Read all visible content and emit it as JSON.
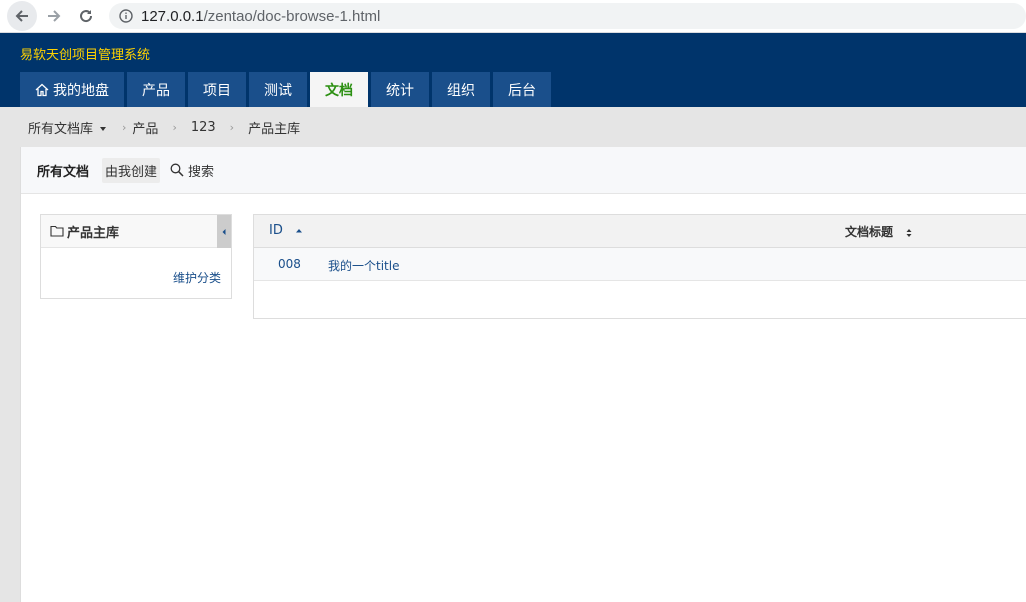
{
  "browser": {
    "url_host": "127.0.0.1",
    "url_path": "/zentao/doc-browse-1.html"
  },
  "app": {
    "title": "易软天创项目管理系统"
  },
  "main_nav": {
    "tabs": [
      {
        "label": "我的地盘",
        "icon": "home-icon"
      },
      {
        "label": "产品"
      },
      {
        "label": "项目"
      },
      {
        "label": "测试"
      },
      {
        "label": "文档",
        "active": true
      },
      {
        "label": "统计"
      },
      {
        "label": "组织"
      },
      {
        "label": "后台"
      }
    ]
  },
  "breadcrumb": {
    "items": [
      "所有文档库",
      "产品",
      "123",
      "产品主库"
    ]
  },
  "sub_nav": {
    "all_docs": "所有文档",
    "created_by_me": "由我创建",
    "search": "搜索"
  },
  "tree": {
    "title": "产品主库",
    "maintain_link": "维护分类"
  },
  "table": {
    "headers": {
      "id": "ID",
      "title": "文档标题"
    },
    "rows": [
      {
        "id": "008",
        "title": "我的一个title"
      }
    ]
  },
  "colors": {
    "header_bg": "#00346b",
    "app_title": "#ffd200",
    "active_tab_text": "#2c9012",
    "link": "#1a4f8b"
  }
}
